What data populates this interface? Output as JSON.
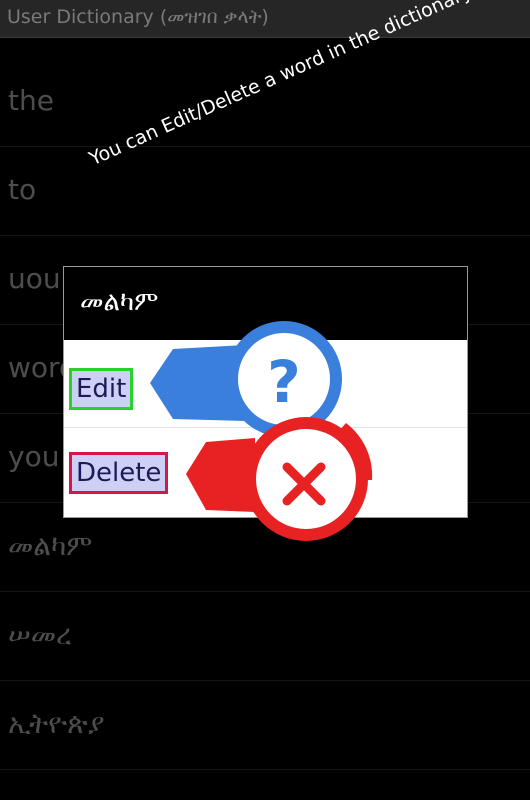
{
  "app": {
    "title": "User Dictionary (መዝገበ ቃላት)"
  },
  "words": [
    {
      "text": "the"
    },
    {
      "text": "to"
    },
    {
      "text": "uou"
    },
    {
      "text": "word"
    },
    {
      "text": "you"
    },
    {
      "text": "መልካም"
    },
    {
      "text": "ሠመረ"
    },
    {
      "text": "ኢትዮጵያ"
    }
  ],
  "tutorial": {
    "hint": "You can Edit/Delete a word in the dictionary."
  },
  "dialog": {
    "title": "መልካም",
    "edit_label": "Edit",
    "delete_label": "Delete"
  },
  "colors": {
    "help_blue": "#3a7fdc",
    "delete_red": "#e82222",
    "edit_outline": "#2bd12b",
    "delete_outline": "#d4164a"
  },
  "icons": {
    "help": "question-mark-icon",
    "delete": "x-icon"
  }
}
